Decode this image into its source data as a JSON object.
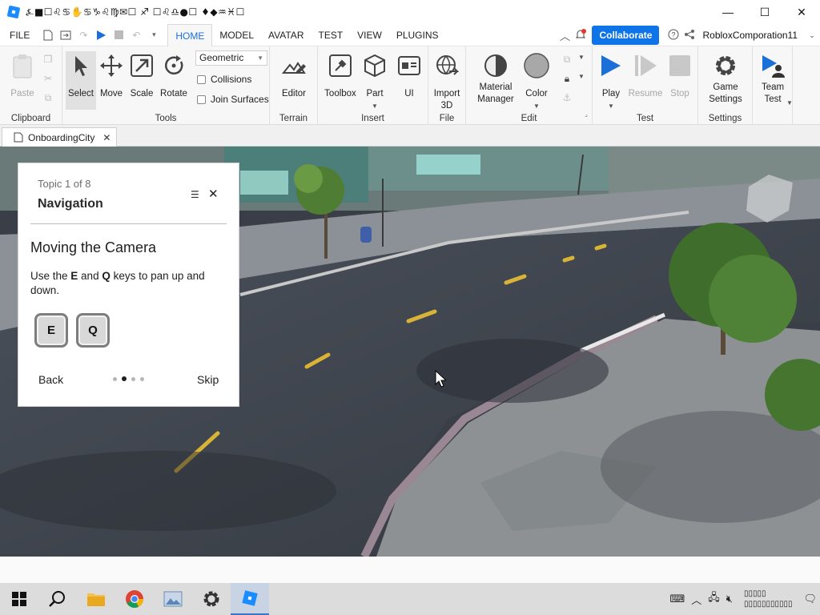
{
  "window": {
    "title": "⍼■☐♌♋✋♋♑♌♍✉☐ ♐ ☐♌♎●☐ ♦◆♒♓☐"
  },
  "menubar": {
    "file": "FILE",
    "tabs": [
      "HOME",
      "MODEL",
      "AVATAR",
      "TEST",
      "VIEW",
      "PLUGINS"
    ],
    "collaborate": "Collaborate",
    "username": "RobloxComporation11"
  },
  "ribbon": {
    "clipboard": {
      "paste": "Paste",
      "label": "Clipboard"
    },
    "tools": {
      "select": "Select",
      "move": "Move",
      "scale": "Scale",
      "rotate": "Rotate",
      "mode": "Geometric",
      "collisions": "Collisions",
      "join_surfaces": "Join Surfaces",
      "label": "Tools"
    },
    "terrain": {
      "editor": "Editor",
      "label": "Terrain"
    },
    "insert": {
      "toolbox": "Toolbox",
      "part": "Part",
      "ui": "UI",
      "label": "Insert"
    },
    "file": {
      "import3d": "Import 3D",
      "label": "File"
    },
    "edit": {
      "material": "Material Manager",
      "color": "Color",
      "label": "Edit"
    },
    "test": {
      "play": "Play",
      "resume": "Resume",
      "stop": "Stop",
      "label": "Test"
    },
    "settings": {
      "game": "Game Settings",
      "label": "Settings"
    },
    "team": {
      "team_test": "Team Test"
    }
  },
  "doc_tab": {
    "name": "OnboardingCity"
  },
  "onboarding": {
    "topic": "Topic 1 of 8",
    "title": "Navigation",
    "heading": "Moving the Camera",
    "desc_before": "Use the ",
    "key1": "E",
    "desc_mid": " and ",
    "key2": "Q",
    "desc_after": " keys to pan up and down.",
    "back": "Back",
    "skip": "Skip",
    "dots_total": 4,
    "dots_active": 2
  },
  "colors": {
    "accent": "#0e74e8",
    "play": "#1a6fd8",
    "road": "#3b4049"
  }
}
